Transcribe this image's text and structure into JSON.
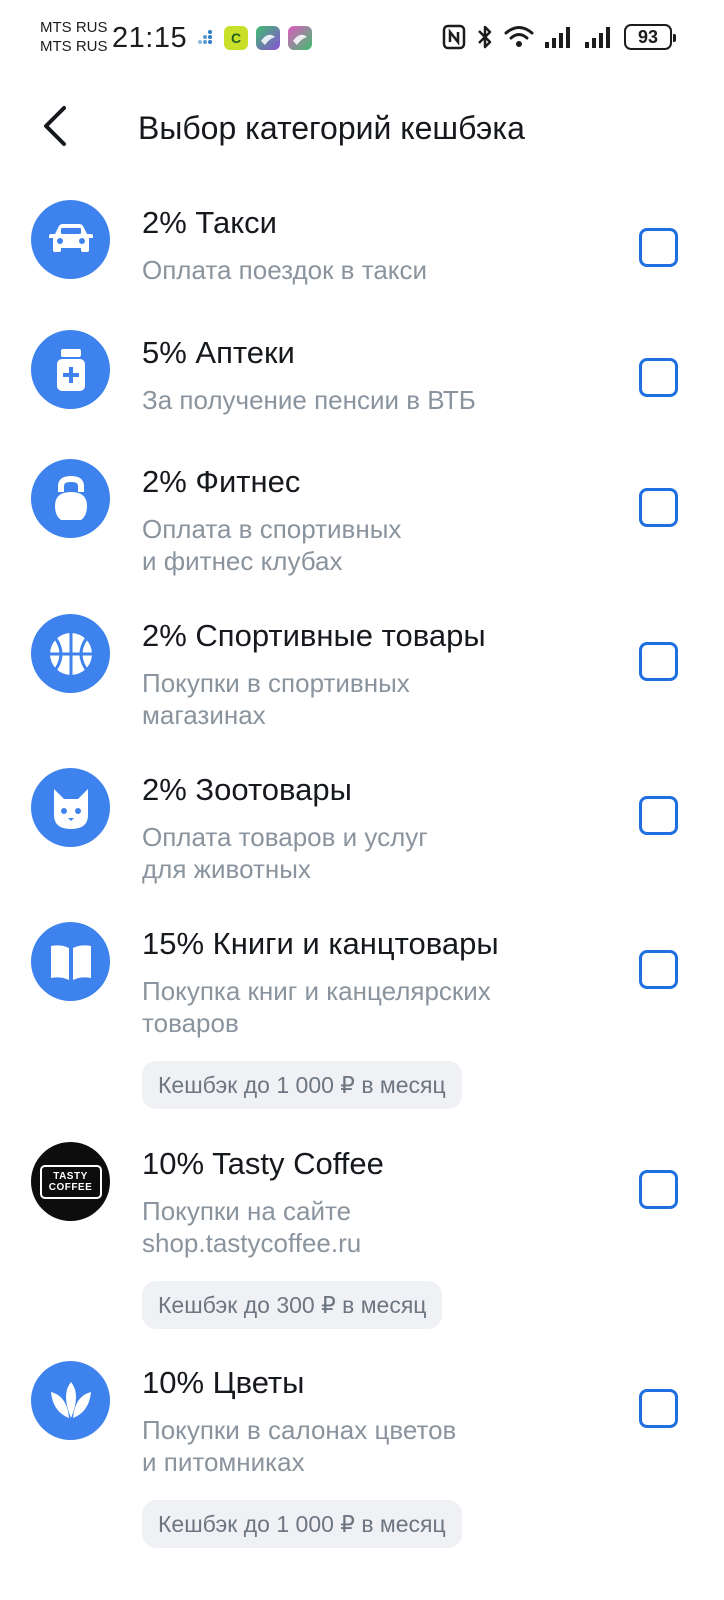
{
  "status_bar": {
    "carrier_1": "MTS RUS",
    "carrier_2": "MTS RUS",
    "time": "21:15",
    "badge_c": "C",
    "battery": "93"
  },
  "header": {
    "title": "Выбор категорий кешбэка"
  },
  "categories": [
    {
      "title": "2% Такси",
      "desc_1": "Оплата поездок в такси",
      "desc_2": "",
      "badge": "",
      "icon": "car-icon",
      "checked": false
    },
    {
      "title": "5% Аптеки",
      "desc_1": "За получение пенсии в ВТБ",
      "desc_2": "",
      "badge": "",
      "icon": "medicine-bottle-icon",
      "checked": false
    },
    {
      "title": "2% Фитнес",
      "desc_1": "Оплата в спортивных",
      "desc_2": "и фитнес клубах",
      "badge": "",
      "icon": "kettlebell-icon",
      "checked": false
    },
    {
      "title": "2% Спортивные товары",
      "desc_1": "Покупки в спортивных",
      "desc_2": "магазинах",
      "badge": "",
      "icon": "basketball-icon",
      "checked": false
    },
    {
      "title": "2% Зоотовары",
      "desc_1": "Оплата товаров и услуг",
      "desc_2": "для животных",
      "badge": "",
      "icon": "cat-icon",
      "checked": false
    },
    {
      "title": "15% Книги и канцтовары",
      "desc_1": "Покупка книг и канцелярских",
      "desc_2": "товаров",
      "badge": "Кешбэк до 1 000 ₽ в месяц",
      "icon": "book-icon",
      "checked": false
    },
    {
      "title": "10% Tasty Coffee",
      "desc_1": "Покупки на сайте",
      "desc_2": "shop.tastycoffee.ru",
      "badge": "Кешбэк до 300 ₽ в месяц",
      "icon": "tasty-coffee-logo",
      "logo_line_1": "TASTY",
      "logo_line_2": "COFFEE",
      "checked": false
    },
    {
      "title": "10% Цветы",
      "desc_1": "Покупки в салонах цветов",
      "desc_2": "и питомниках",
      "badge": "Кешбэк до 1 000 ₽ в месяц",
      "icon": "flower-icon",
      "checked": false
    }
  ],
  "colors": {
    "accent": "#3e82ee",
    "checkbox": "#1f6fe0",
    "secondary_text": "#8a949e",
    "badge_bg": "#eff1f4"
  }
}
